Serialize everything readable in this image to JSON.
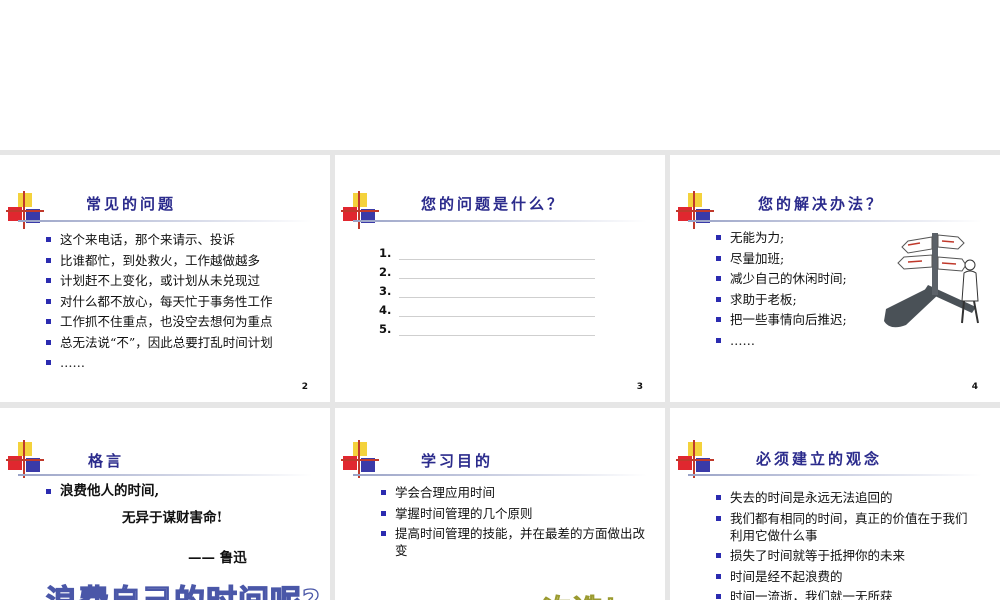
{
  "slides": [
    {
      "title": "常见的问题",
      "bullets": [
        "这个来电话，那个来请示、投诉",
        "比谁都忙，到处救火，工作越做越多",
        "计划赶不上变化，或计划从未兑现过",
        "对什么都不放心，每天忙于事务性工作",
        "工作抓不住重点，也没空去想何为重点",
        "总无法说“不”，因此总要打乱时间计划",
        "……"
      ],
      "page": "2"
    },
    {
      "title": "您的问题是什么？",
      "blanks": [
        "1.",
        "2.",
        "3.",
        "4.",
        "5."
      ],
      "page": "3"
    },
    {
      "title": "您的解决办法？",
      "bullets": [
        "无能为力;",
        "尽量加班;",
        "减少自己的休闲时间;",
        "求助于老板;",
        "把一些事情向后推迟;",
        "……"
      ],
      "page": "4",
      "clipart": "signpost-businessman-illustration"
    },
    {
      "title": "格言",
      "bullets": [
        "浪费他人的时间,"
      ],
      "quote_line": "无异于谋财害命!",
      "quote_author": "—— 鲁迅",
      "big_text": "浪费自己的时间呢?"
    },
    {
      "title": "学习目的",
      "bullets": [
        "学会合理应用时间",
        "掌握时间管理的几个原则",
        "提高时间管理的技能，并在最差的方面做出改变"
      ],
      "big_text": "一次选！"
    },
    {
      "title": "必须建立的观念",
      "bullets": [
        "失去的时间是永远无法追回的",
        "我们都有相同的时间，真正的价值在于我们利用它做什么事",
        "损失了时间就等于抵押你的未来",
        "时间是经不起浪费的",
        "时间一流逝，我们就一无所获"
      ]
    }
  ],
  "colors": {
    "title": "#2b2b8c",
    "bullet": "#2b2bb0",
    "background": "#e6e6e6"
  }
}
